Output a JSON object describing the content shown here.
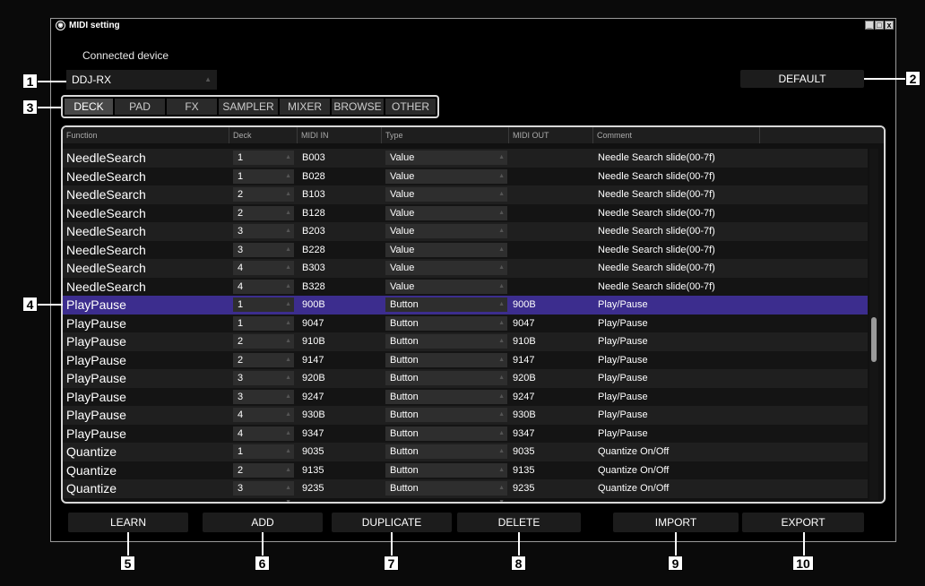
{
  "window": {
    "title": "MIDI setting",
    "controls": [
      "_",
      "□",
      "x"
    ]
  },
  "device": {
    "label": "Connected device",
    "selected": "DDJ-RX"
  },
  "default_label": "DEFAULT",
  "tabs": [
    {
      "label": "DECK",
      "active": true
    },
    {
      "label": "PAD",
      "active": false
    },
    {
      "label": "FX",
      "active": false
    },
    {
      "label": "SAMPLER",
      "active": false
    },
    {
      "label": "MIXER",
      "active": false
    },
    {
      "label": "BROWSE",
      "active": false
    },
    {
      "label": "OTHER",
      "active": false
    }
  ],
  "table": {
    "headers": [
      "Function",
      "Deck",
      "MIDI IN",
      "Type",
      "MIDI OUT",
      "Comment"
    ],
    "rows": [
      {
        "function": "NeedleSearch",
        "deck": "1",
        "midi_in": "B003",
        "type": "Value",
        "midi_out": "",
        "comment": "Needle Search slide(00-7f)"
      },
      {
        "function": "NeedleSearch",
        "deck": "1",
        "midi_in": "B028",
        "type": "Value",
        "midi_out": "",
        "comment": "Needle Search slide(00-7f)"
      },
      {
        "function": "NeedleSearch",
        "deck": "2",
        "midi_in": "B103",
        "type": "Value",
        "midi_out": "",
        "comment": "Needle Search slide(00-7f)"
      },
      {
        "function": "NeedleSearch",
        "deck": "2",
        "midi_in": "B128",
        "type": "Value",
        "midi_out": "",
        "comment": "Needle Search slide(00-7f)"
      },
      {
        "function": "NeedleSearch",
        "deck": "3",
        "midi_in": "B203",
        "type": "Value",
        "midi_out": "",
        "comment": "Needle Search slide(00-7f)"
      },
      {
        "function": "NeedleSearch",
        "deck": "3",
        "midi_in": "B228",
        "type": "Value",
        "midi_out": "",
        "comment": "Needle Search slide(00-7f)"
      },
      {
        "function": "NeedleSearch",
        "deck": "4",
        "midi_in": "B303",
        "type": "Value",
        "midi_out": "",
        "comment": "Needle Search slide(00-7f)"
      },
      {
        "function": "NeedleSearch",
        "deck": "4",
        "midi_in": "B328",
        "type": "Value",
        "midi_out": "",
        "comment": "Needle Search slide(00-7f)"
      },
      {
        "function": "PlayPause",
        "deck": "1",
        "midi_in": "900B",
        "type": "Button",
        "midi_out": "900B",
        "comment": "Play/Pause",
        "selected": true
      },
      {
        "function": "PlayPause",
        "deck": "1",
        "midi_in": "9047",
        "type": "Button",
        "midi_out": "9047",
        "comment": "Play/Pause"
      },
      {
        "function": "PlayPause",
        "deck": "2",
        "midi_in": "910B",
        "type": "Button",
        "midi_out": "910B",
        "comment": "Play/Pause"
      },
      {
        "function": "PlayPause",
        "deck": "2",
        "midi_in": "9147",
        "type": "Button",
        "midi_out": "9147",
        "comment": "Play/Pause"
      },
      {
        "function": "PlayPause",
        "deck": "3",
        "midi_in": "920B",
        "type": "Button",
        "midi_out": "920B",
        "comment": "Play/Pause"
      },
      {
        "function": "PlayPause",
        "deck": "3",
        "midi_in": "9247",
        "type": "Button",
        "midi_out": "9247",
        "comment": "Play/Pause"
      },
      {
        "function": "PlayPause",
        "deck": "4",
        "midi_in": "930B",
        "type": "Button",
        "midi_out": "930B",
        "comment": "Play/Pause"
      },
      {
        "function": "PlayPause",
        "deck": "4",
        "midi_in": "9347",
        "type": "Button",
        "midi_out": "9347",
        "comment": "Play/Pause"
      },
      {
        "function": "Quantize",
        "deck": "1",
        "midi_in": "9035",
        "type": "Button",
        "midi_out": "9035",
        "comment": "Quantize On/Off"
      },
      {
        "function": "Quantize",
        "deck": "2",
        "midi_in": "9135",
        "type": "Button",
        "midi_out": "9135",
        "comment": "Quantize On/Off"
      },
      {
        "function": "Quantize",
        "deck": "3",
        "midi_in": "9235",
        "type": "Button",
        "midi_out": "9235",
        "comment": "Quantize On/Off"
      }
    ]
  },
  "buttons": {
    "learn": "LEARN",
    "add": "ADD",
    "duplicate": "DUPLICATE",
    "delete": "DELETE",
    "import": "IMPORT",
    "export": "EXPORT"
  },
  "callouts": [
    "1",
    "2",
    "3",
    "4",
    "5",
    "6",
    "7",
    "8",
    "9",
    "10"
  ],
  "colors": {
    "selected_row": "#3c2d8e",
    "background": "#000000"
  }
}
